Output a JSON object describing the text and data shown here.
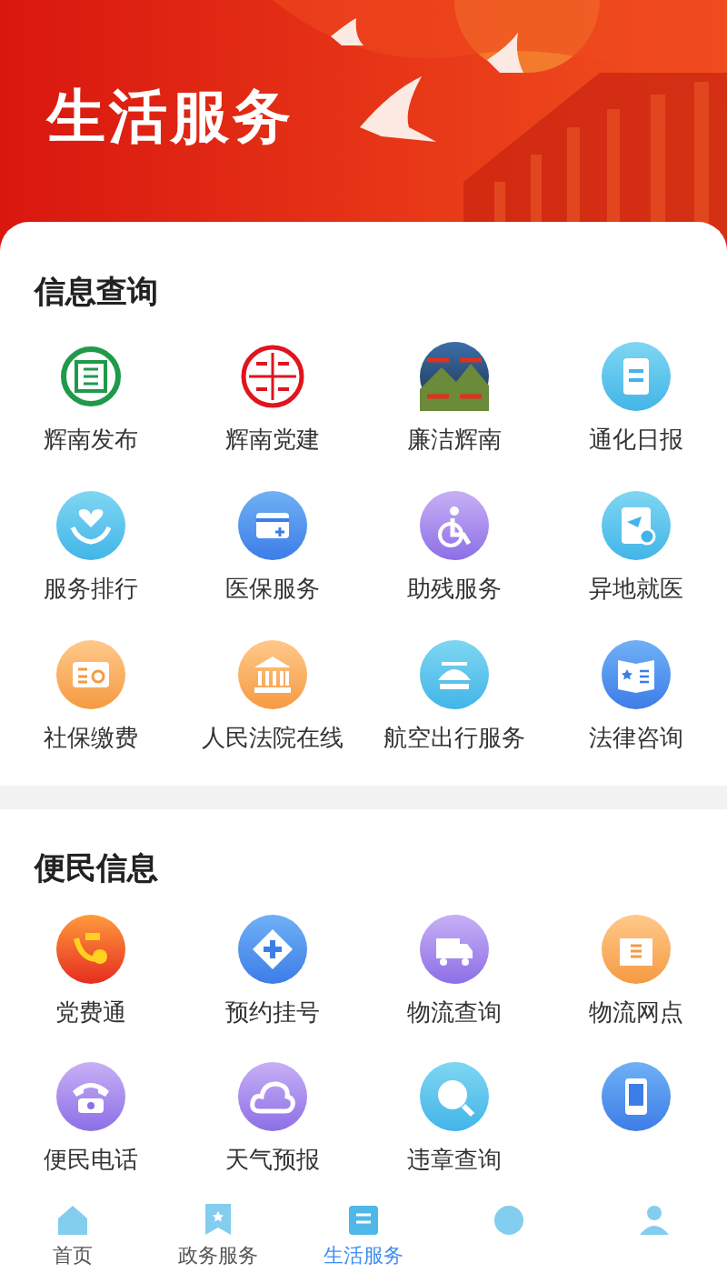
{
  "banner": {
    "title": "生活服务"
  },
  "sections": [
    {
      "title": "信息查询",
      "items": [
        {
          "kind": "labelled",
          "label": "辉南发布"
        },
        {
          "kind": "labelled",
          "label": "辉南党建"
        },
        {
          "kind": "labelled",
          "label": "廉洁辉南"
        },
        {
          "kind": "labelled",
          "label": "通化日报"
        },
        {
          "kind": "labelled",
          "label": "服务排行"
        },
        {
          "kind": "labelled",
          "label": "医保服务"
        },
        {
          "kind": "labelled",
          "label": "助残服务"
        },
        {
          "kind": "labelled",
          "label": "异地就医"
        },
        {
          "kind": "labelled",
          "label": "社保缴费"
        },
        {
          "kind": "labelled",
          "label": "人民法院在线"
        },
        {
          "kind": "labelled",
          "label": "航空出行服务"
        },
        {
          "kind": "labelled",
          "label": "法律咨询"
        }
      ]
    },
    {
      "title": "便民信息",
      "items": [
        {
          "kind": "labelled",
          "label": "党费通"
        },
        {
          "kind": "labelled",
          "label": "预约挂号"
        },
        {
          "kind": "labelled",
          "label": "物流查询"
        },
        {
          "kind": "labelled",
          "label": "物流网点"
        },
        {
          "kind": "labelled",
          "label": "便民电话"
        },
        {
          "kind": "labelled",
          "label": "天气预报"
        },
        {
          "kind": "labelled",
          "label": "违章查询"
        },
        {
          "kind": "icon"
        }
      ]
    }
  ],
  "tab_bar": [
    {
      "label": "首页",
      "selected": false
    },
    {
      "label": "政务服务",
      "selected": false
    },
    {
      "label": "生活服务",
      "selected": true
    },
    {
      "selected": false
    },
    {
      "selected": false
    }
  ]
}
